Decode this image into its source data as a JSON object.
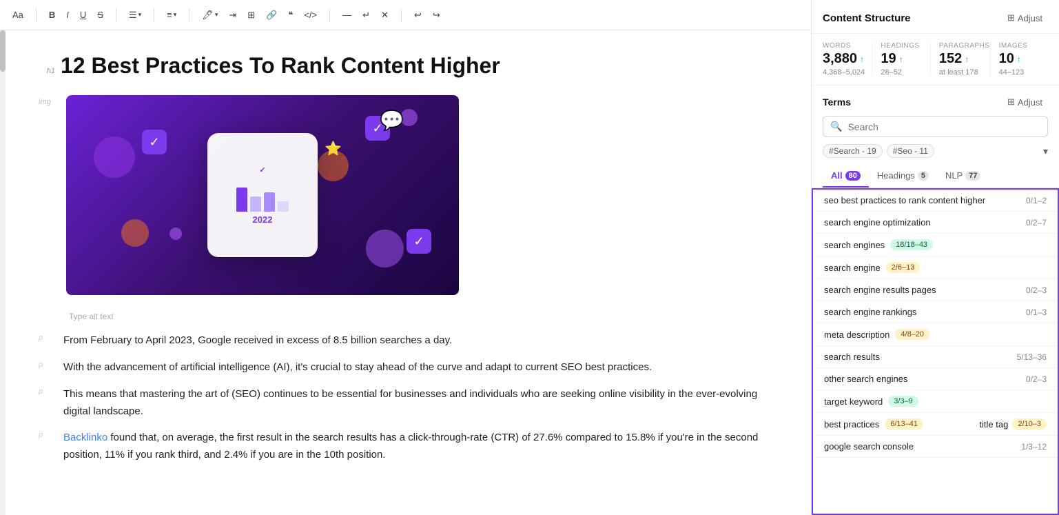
{
  "toolbar": {
    "font_btn": "Aa",
    "bold": "B",
    "italic": "I",
    "underline": "U",
    "strikethrough": "S",
    "align": "≡",
    "list": "≡",
    "link": "🔗",
    "image": "⊞",
    "email": "✉",
    "anchor": "⚓",
    "quote": "❝",
    "code": "</>",
    "divider": "—",
    "undo": "↩",
    "redo": "↪",
    "clear": "✕"
  },
  "article": {
    "h1_label": "h1",
    "title": "12 Best Practices To Rank Content Higher",
    "img_label": "img",
    "alt_text_placeholder": "Type alt text",
    "paragraphs": [
      {
        "label": "p",
        "text": "From February to April 2023, Google received in excess of 8.5 billion searches a day."
      },
      {
        "label": "p",
        "text": "With the advancement of artificial intelligence (AI), it's crucial to stay ahead of the curve and adapt to current SEO best practices."
      },
      {
        "label": "p",
        "text": "This means that mastering the art of (SEO) continues to be essential for businesses and individuals who are seeking online visibility in the ever-evolving digital landscape."
      },
      {
        "label": "p",
        "text_before_link": "",
        "link_text": "Backlinko",
        "link_url": "#",
        "text_after_link": " found that, on average, the first result in the search results has a click-through-rate (CTR) of 27.6% compared to 15.8% if you're in the second position, 11% if you rank third, and 2.4% if you are in the 10th position."
      }
    ]
  },
  "sidebar": {
    "title": "Content Structure",
    "adjust_label": "Adjust",
    "stats": {
      "words": {
        "label": "WORDS",
        "value": "3,880",
        "arrow": "↑",
        "range": "4,368–5,024"
      },
      "headings": {
        "label": "HEADINGS",
        "value": "19",
        "arrow": "↑",
        "range": "28–52"
      },
      "paragraphs": {
        "label": "PARAGRAPHS",
        "value": "152",
        "arrow": "↑",
        "range": "at least 178"
      },
      "images": {
        "label": "IMAGES",
        "value": "10",
        "arrow": "↑",
        "range": "44–123"
      }
    },
    "terms_title": "Terms",
    "terms_adjust_label": "Adjust",
    "search_placeholder": "Search",
    "tag1": "#Search - 19",
    "tag2": "#Seo - 11",
    "tabs": [
      {
        "label": "All",
        "badge": "80",
        "badge_style": "purple",
        "active": true
      },
      {
        "label": "Headings",
        "badge": "5",
        "badge_style": "gray",
        "active": false
      },
      {
        "label": "NLP",
        "badge": "77",
        "badge_style": "gray",
        "active": false
      }
    ],
    "terms": [
      {
        "text": "seo best practices to rank content higher",
        "badge": null,
        "count": "0/1–2"
      },
      {
        "text": "search engine optimization",
        "badge": null,
        "count": "0/2–7"
      },
      {
        "text": "search engines",
        "badge_text": "18/18–43",
        "badge_style": "green",
        "count": null
      },
      {
        "text": "search engine",
        "badge_text": "2/6–13",
        "badge_style": "yellow",
        "count": null
      },
      {
        "text": "search engine results pages",
        "badge": null,
        "count": "0/2–3"
      },
      {
        "text": "search engine rankings",
        "badge": null,
        "count": "0/1–3"
      },
      {
        "text": "meta description",
        "badge_text": "4/8–20",
        "badge_style": "yellow",
        "count": null
      },
      {
        "text": "search results",
        "badge": null,
        "count": "5/13–36"
      },
      {
        "text": "other search engines",
        "badge": null,
        "count": "0/2–3"
      },
      {
        "text": "target keyword",
        "badge_text": "3/3–9",
        "badge_style": "green",
        "count": null
      },
      {
        "text": "best practices",
        "badge_text": "6/13–41",
        "badge_style": "yellow",
        "count": null
      },
      {
        "text": "title tag",
        "badge_text": "2/10–3",
        "badge_style": "yellow",
        "count": null
      },
      {
        "text": "google search console",
        "badge": null,
        "count": "1/3–12"
      }
    ]
  }
}
